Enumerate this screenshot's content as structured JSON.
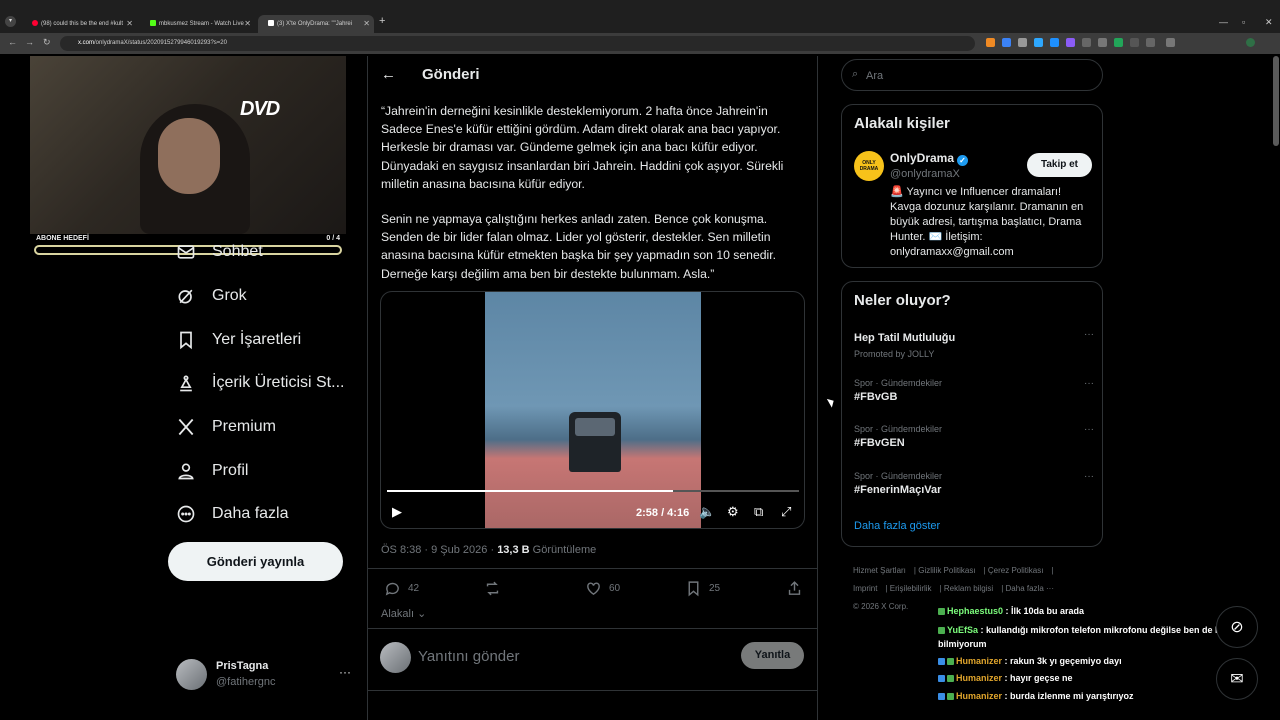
{
  "browser": {
    "tabs": [
      {
        "label": "(98) could this be the end #kult",
        "icon": "youtube-icon",
        "color": "#ff0033"
      },
      {
        "label": "mbkusmez Stream - Watch Live",
        "icon": "kick-icon",
        "color": "#53fc18"
      },
      {
        "label": "(3) X'te OnlyDrama: \"\"Jahrei",
        "icon": "x-icon",
        "color": "#ffffff"
      }
    ],
    "url_domain": "x.com",
    "url_path": "/onlydramaX/status/2020915279946019293?s=20"
  },
  "stream_overlay": {
    "logo": "DVD",
    "goal_label": "ABONE HEDEFİ",
    "goal_count": "0 / 4",
    "goal_progress": 0
  },
  "sidebar": {
    "items": [
      {
        "label": "Sohbet",
        "icon": "mail-icon"
      },
      {
        "label": "Grok",
        "icon": "grok-icon"
      },
      {
        "label": "Yer İşaretleri",
        "icon": "bookmark-icon"
      },
      {
        "label": "İçerik Üreticisi St...",
        "icon": "creator-studio-icon"
      },
      {
        "label": "Premium",
        "icon": "x-logo-icon"
      },
      {
        "label": "Profil",
        "icon": "profile-icon"
      },
      {
        "label": "Daha fazla",
        "icon": "more-circle-icon"
      }
    ],
    "post_button": "Gönderi yayınla",
    "account": {
      "name": "PrisTagna",
      "handle": "@fatihergnc"
    }
  },
  "post": {
    "header": "Gönderi",
    "paragraph1": "“Jahrein'in derneğini kesinlikle desteklemiyorum. 2 hafta önce Jahrein'in Sadece Enes'e küfür ettiğini gördüm. Adam direkt olarak ana bacı yapıyor. Herkesle bir draması var. Gündeme gelmek için ana bacı küfür ediyor. Dünyadaki en saygısız insanlardan biri Jahrein. Haddini çok aşıyor. Sürekli milletin anasına bacısına küfür ediyor.",
    "paragraph2": "Senin ne yapmaya çalıştığını herkes anladı zaten. Bence çok konuşma. Senden de bir lider falan olmaz. Lider yol gösterir, destekler. Sen milletin anasına bacısına küfür etmekten başka bir şey yapmadın son 10 senedir. Derneğe karşı değilim ama ben bir destekte bulunmam. Asla.”",
    "video": {
      "time": "2:58 / 4:16",
      "progress": 0.695
    },
    "timestamp": "ÖS 8:38 · 9 Şub 2026 · ",
    "views": "13,3 B",
    "views_label": " Görüntüleme",
    "actions": {
      "replies": "42",
      "reposts": "",
      "likes": "60",
      "bookmarks": "25"
    },
    "relevant": "Alakalı",
    "reply_placeholder": "Yanıtını gönder",
    "reply_button": "Yanıtla"
  },
  "right": {
    "search_placeholder": "Ara",
    "related_title": "Alakalı kişiler",
    "related_person": {
      "name": "OnlyDrama",
      "handle": "@onlydramaX",
      "follow": "Takip et",
      "bio": "🚨 Yayıncı ve Influencer dramaları! Kavga dozunuz karşılanır. Dramanın en büyük adresi, tartışma başlatıcı, Drama Hunter. ✉️ İletişim: onlydramaxx@gmail.com"
    },
    "trends_title": "Neler oluyor?",
    "trends": [
      {
        "category": "",
        "name": "Hep Tatil Mutluluğu",
        "promo": "Promoted by JOLLY"
      },
      {
        "category": "Spor · Gündemdekiler",
        "name": "#FBvGB",
        "promo": ""
      },
      {
        "category": "Spor · Gündemdekiler",
        "name": "#FBvGEN",
        "promo": ""
      },
      {
        "category": "Spor · Gündemdekiler",
        "name": "#FenerinMaçıVar",
        "promo": ""
      }
    ],
    "show_more": "Daha fazla göster",
    "footer": [
      "Hizmet Şartları",
      "Gizlilik Politikası",
      "Çerez Politikası",
      "Imprint",
      "Erişilebilirlik",
      "Reklam bilgisi",
      "Daha fazla ···",
      "© 2026 X Corp."
    ]
  },
  "chat": [
    {
      "user": "Hephaestus0",
      "color": "#7cfc7c",
      "msg": "İlk 10da bu arada"
    },
    {
      "user": "YuEfSa",
      "color": "#7cfc7c",
      "msg": "kullandığı mikrofon telefon mikrofonu değilse ben de bir şey bilmiyorum"
    },
    {
      "user": "Humanizer",
      "color": "#e0a52c",
      "msg": "rakun 3k yı geçemiyo dayı"
    },
    {
      "user": "Humanizer",
      "color": "#e0a52c",
      "msg": "hayır geçse ne"
    },
    {
      "user": "Humanizer",
      "color": "#e0a52c",
      "msg": "burda izlenme mi yarıştırıyoz"
    }
  ],
  "colors": {
    "accent": "#1d9bf0",
    "bg": "#000000",
    "border": "#2f3336",
    "muted": "#71767b"
  }
}
